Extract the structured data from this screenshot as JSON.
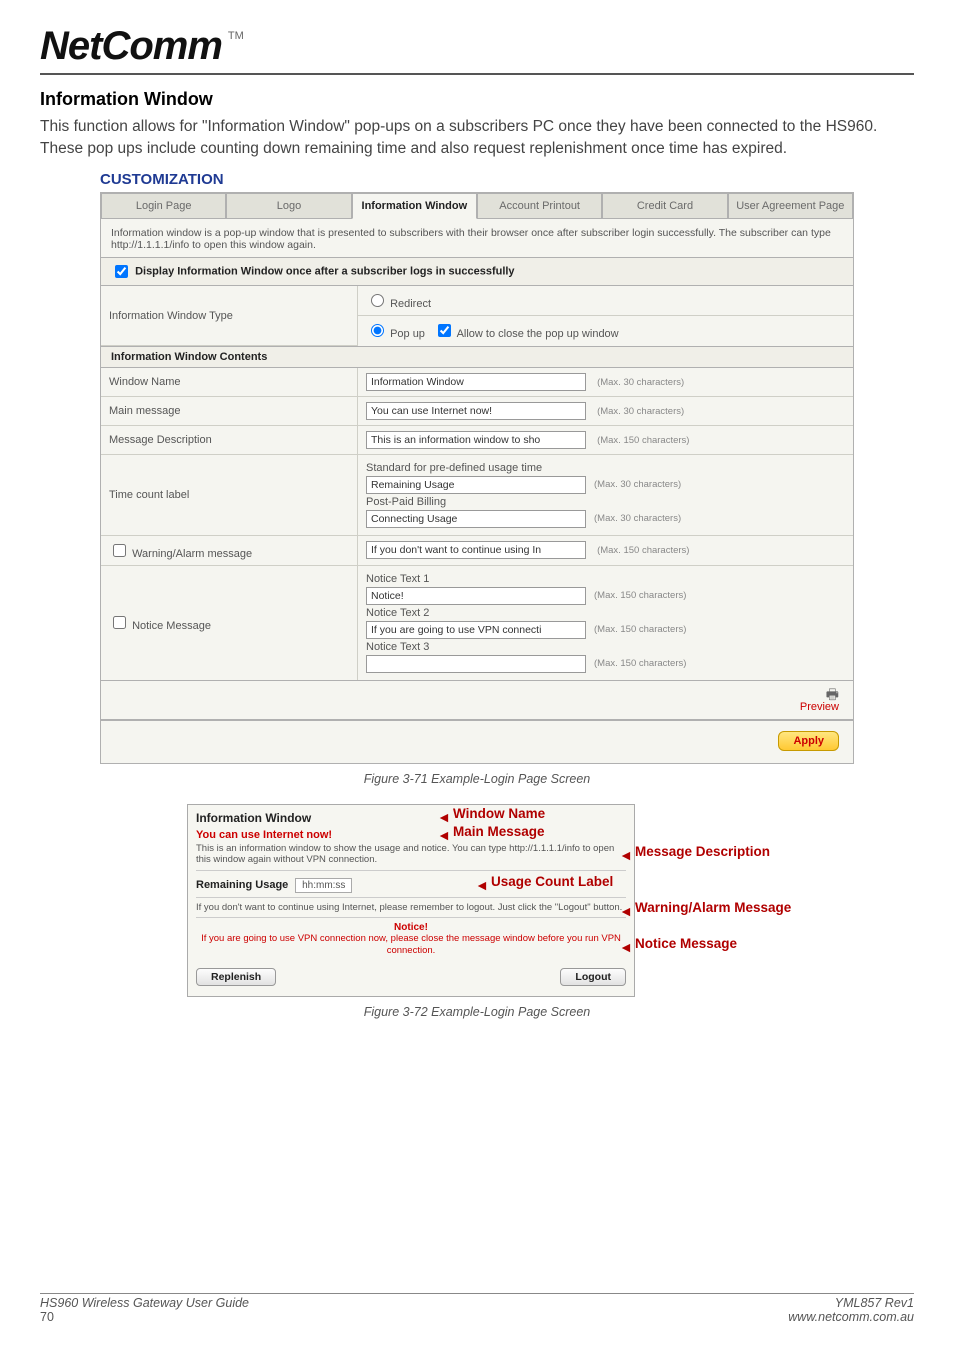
{
  "logo": {
    "text": "NetComm",
    "tm": "TM"
  },
  "heading": "Information Window",
  "intro": "This function allows for \"Information Window\" pop-ups on a subscribers PC once they have been connected to the HS960. These pop ups include counting down remaining time and also request replenishment once time has expired.",
  "customization": {
    "title": "CUSTOMIZATION",
    "tabs": {
      "login": "Login Page",
      "logo": "Logo",
      "info": "Information Window",
      "account": "Account Printout",
      "credit": "Credit Card",
      "user_agreement": "User Agreement Page"
    },
    "description": "Information window is a pop-up window that is presented to subscribers with their browser once after subscriber login successfully. The subscriber can type http://1.1.1.1/info to open this window again.",
    "display_checkbox_label": "Display Information Window once after a subscriber logs in successfully",
    "rows": {
      "info_window_type": {
        "label": "Information Window Type",
        "redirect": "Redirect",
        "popup": "Pop up",
        "popup_allow": "Allow to close the pop up window"
      },
      "contents_header": "Information Window Contents",
      "window_name": {
        "label": "Window Name",
        "value": "Information Window",
        "hint": "(Max. 30 characters)"
      },
      "main_message": {
        "label": "Main message",
        "value": "You can use Internet now!",
        "hint": "(Max. 30 characters)"
      },
      "message_description": {
        "label": "Message Description",
        "value": "This is an information window to sho",
        "hint": "(Max. 150 characters)"
      },
      "time_count": {
        "label": "Time count label",
        "std_text": "Standard for pre-defined usage time",
        "remaining_value": "Remaining Usage",
        "remaining_hint": "(Max. 30 characters)",
        "postpaid": "Post-Paid Billing",
        "connecting_value": "Connecting Usage",
        "connecting_hint": "(Max. 30 characters)"
      },
      "warning": {
        "label": "Warning/Alarm message",
        "value": "If you don't want to continue using In",
        "hint": "(Max. 150 characters)"
      },
      "notice": {
        "label": "Notice Message",
        "t1": "Notice Text 1",
        "v1": "Notice!",
        "h1": "(Max. 150 characters)",
        "t2": "Notice Text 2",
        "v2": "If you are going to use VPN connecti",
        "h2": "(Max. 150 characters)",
        "t3": "Notice Text 3",
        "v3": "",
        "h3": "(Max. 150 characters)"
      }
    },
    "preview": "Preview",
    "apply": "Apply"
  },
  "figure_caption_1": "Figure 3-71 Example-Login Page Screen",
  "popup": {
    "title": "Information Window",
    "main_msg": "You can use Internet now!",
    "desc": "This is an information window to show the usage and notice. You can type http://1.1.1.1/info to open this window again without VPN connection.",
    "usage_label": "Remaining Usage",
    "usage_value": "hh:mm:ss",
    "warn_text": "If you don't want to continue using Internet, please remember to logout. Just click the \"Logout\" button.",
    "notice_title": "Notice!",
    "notice_text": "If you are going to use VPN connection now, please close the message window before you run VPN connection.",
    "btn_replenish": "Replenish",
    "btn_logout": "Logout",
    "ann": {
      "window_name": "Window Name",
      "main_message": "Main Message",
      "message_description": "Message Description",
      "usage_count_label": "Usage Count Label",
      "warning_alarm": "Warning/Alarm Message",
      "notice_message": "Notice Message"
    }
  },
  "figure_caption_2": "Figure 3-72 Example-Login Page Screen",
  "footer": {
    "left_line1": "HS960 Wireless Gateway User Guide",
    "page_num": "70",
    "right_line1": "YML857 Rev1",
    "right_line2": "www.netcomm.com.au"
  }
}
